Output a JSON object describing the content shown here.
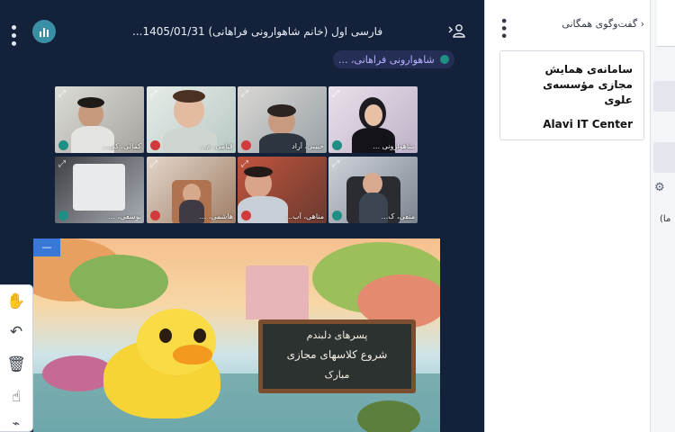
{
  "header": {
    "title": "فارسی اول (خانم شاهوارونی فراهانی) 1405/01/31...",
    "presenter_chip": "شاهوارونی فراهانی، ..."
  },
  "participants": [
    {
      "name": "شاهوارونی ...",
      "mic": "on"
    },
    {
      "name": "حبیبی، آراد",
      "mic": "off"
    },
    {
      "name": "قیامی، م...",
      "mic": "off"
    },
    {
      "name": "کمالی، کی...",
      "mic": "on"
    },
    {
      "name": "منفی، ک...",
      "mic": "on"
    },
    {
      "name": "مناهی، آب...",
      "mic": "off"
    },
    {
      "name": "هاشمی، ...",
      "mic": "off"
    },
    {
      "name": "یوسفی، ...",
      "mic": "on"
    }
  ],
  "slide": {
    "line1": "پسرهای دلبندم",
    "line2": "شروع کلاسهای مجازی",
    "line3": "مبارک",
    "pin_label": "—"
  },
  "toolbar": [
    "hand-icon",
    "undo-icon",
    "trash-icon",
    "pointer-icon",
    "chart-icon"
  ],
  "chat": {
    "header": "گفت‌وگوی همگانی",
    "card_title": "سامانه‌ی همایش مجازی مؤسسه‌ی علوی",
    "card_subtitle": "Alavi IT Center"
  },
  "side": {
    "partial_text": "(ما"
  },
  "colors": {
    "stage_bg": "#14213a",
    "mic_on": "#1f8f86",
    "mic_off": "#d23b3b",
    "accent": "#3b8fa5"
  }
}
